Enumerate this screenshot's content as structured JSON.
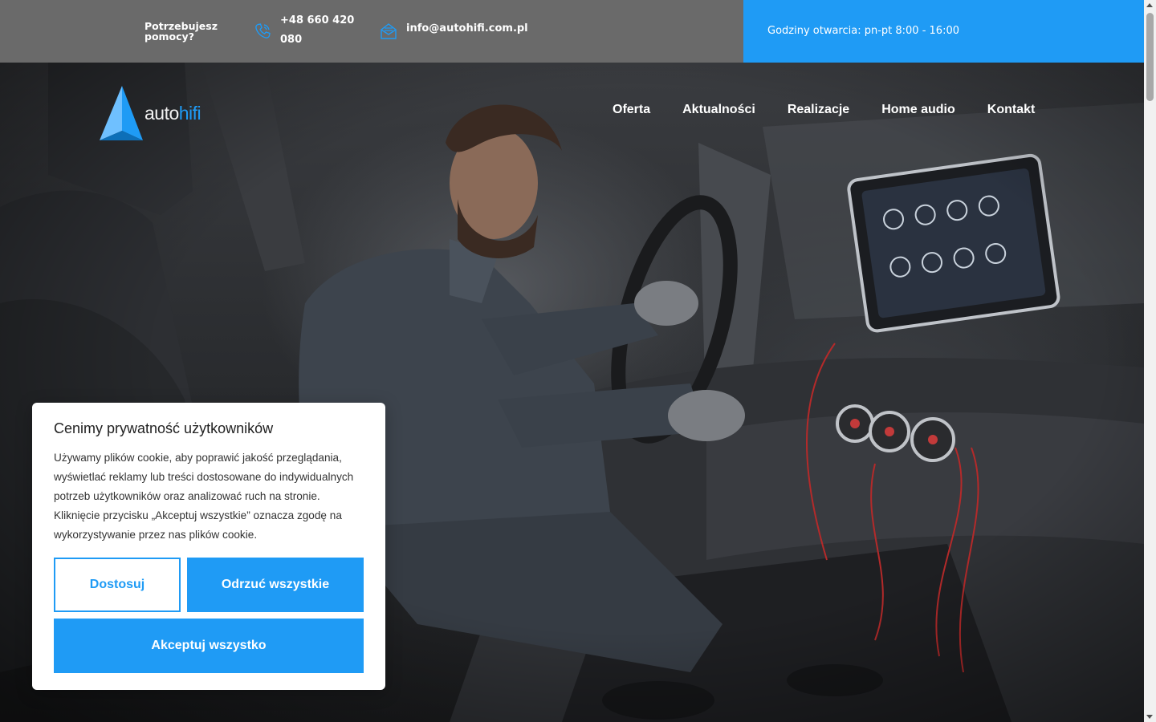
{
  "topbar": {
    "help_text": "Potrzebujesz pomocy?",
    "phone": "+48 660 420 080",
    "email": "info@autohifi.com.pl",
    "hours": "Godziny otwarcia: pn-pt 8:00 - 16:00",
    "phone_icon": "phone-icon",
    "mail_icon": "mail-icon"
  },
  "brand": {
    "logo_part1": "auto",
    "logo_part2": "hifi"
  },
  "nav": {
    "items": [
      "Oferta",
      "Aktualności",
      "Realizacje",
      "Home audio",
      "Kontakt"
    ]
  },
  "cookie": {
    "title": "Cenimy prywatność użytkowników",
    "body": "Używamy plików cookie, aby poprawić jakość przeglądania, wyświetlać reklamy lub treści dostosowane do indywidualnych potrzeb użytkowników oraz analizować ruch na stronie. Kliknięcie przycisku „Akceptuj wszystkie” oznacza zgodę na wykorzystywanie przez nas plików cookie.",
    "customize_label": "Dostosuj",
    "reject_label": "Odrzuć wszystkie",
    "accept_label": "Akceptuj wszystko"
  },
  "colors": {
    "accent": "#1f9bf5",
    "topbar_bg": "#6a6a6a"
  }
}
